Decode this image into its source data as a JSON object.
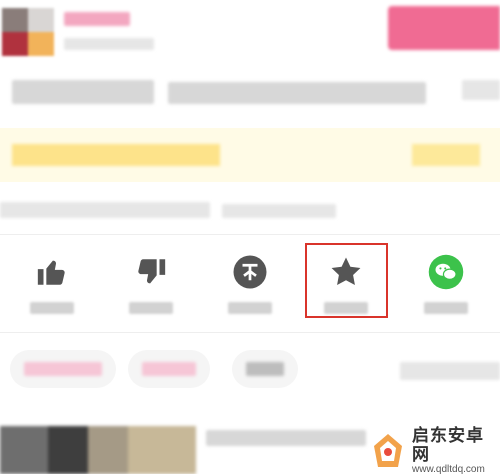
{
  "colors": {
    "accent_pink": "#f06b93",
    "banner_bg": "#fffbe6",
    "banner_bar": "#fde38a",
    "icon_gray": "#555555",
    "wechat_green": "#3cc24b",
    "highlight_red": "#d9342b"
  },
  "actions": [
    {
      "name": "like",
      "icon": "thumbs-up-icon"
    },
    {
      "name": "dislike",
      "icon": "thumbs-down-icon"
    },
    {
      "name": "coin",
      "icon": "coin-icon"
    },
    {
      "name": "favorite",
      "icon": "star-icon",
      "highlighted": true
    },
    {
      "name": "share-wechat",
      "icon": "wechat-icon"
    }
  ],
  "watermark": {
    "title": "启东安卓网",
    "url": "www.qdltdq.com"
  }
}
